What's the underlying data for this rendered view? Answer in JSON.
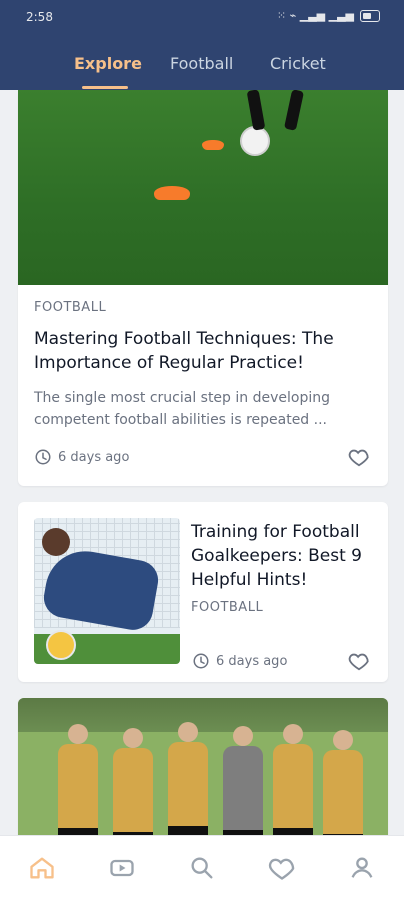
{
  "status": {
    "time": "2:58",
    "icons_text": "⁙ ⌁ ▁▃▅ ▁▃▅"
  },
  "tabs": [
    {
      "label": "Explore"
    },
    {
      "label": "Football"
    },
    {
      "label": "Cricket"
    }
  ],
  "cards": [
    {
      "category": "FOOTBALL",
      "title": "Mastering Football Techniques: The Importance of Regular Practice!",
      "excerpt": "The single most crucial step in developing competent football abilities is repeated ...",
      "time": "6 days ago"
    },
    {
      "title": "Training for Football Goalkeepers: Best 9 Helpful Hints!",
      "category": "FOOTBALL",
      "time": "6 days ago"
    }
  ],
  "colors": {
    "header": "#2f4470",
    "accent": "#f7c08a"
  },
  "icons": {
    "clock": "clock-icon",
    "heart": "heart-icon",
    "home": "home-icon",
    "video": "video-icon",
    "search": "search-icon",
    "favorites": "heart-icon",
    "profile": "user-icon"
  }
}
